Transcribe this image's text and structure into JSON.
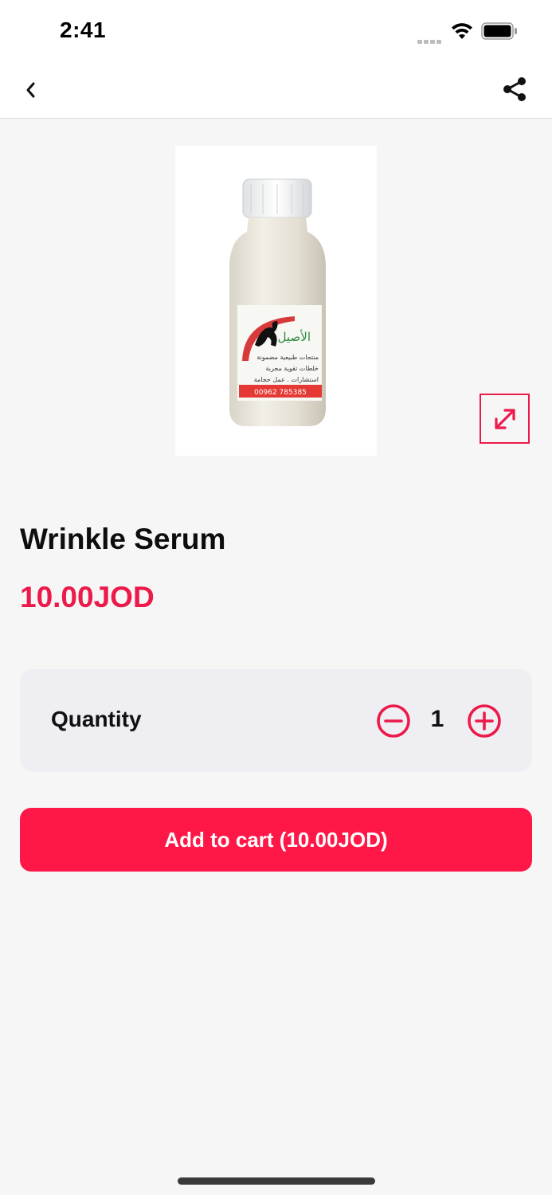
{
  "status_bar": {
    "time": "2:41",
    "icons": [
      "signal-icon",
      "wifi-icon",
      "battery-icon"
    ]
  },
  "nav": {
    "icons": [
      "back-chevron-icon",
      "share-icon"
    ]
  },
  "product": {
    "title": "Wrinkle Serum",
    "price": "10.00JOD",
    "image_label_text": [
      "الأصيل",
      "منتجات طبيعية مضمونة",
      "خلطات تقوية مجربة",
      "استشارات . عمل حجامة",
      "00962 785385"
    ]
  },
  "quantity": {
    "label": "Quantity",
    "value": "1"
  },
  "cart": {
    "button_label": "Add to cart (10.00JOD)"
  },
  "colors": {
    "accent": "#ec1a4a",
    "button": "#ff1747",
    "background": "#f6f6f6",
    "card": "#efeff3"
  }
}
